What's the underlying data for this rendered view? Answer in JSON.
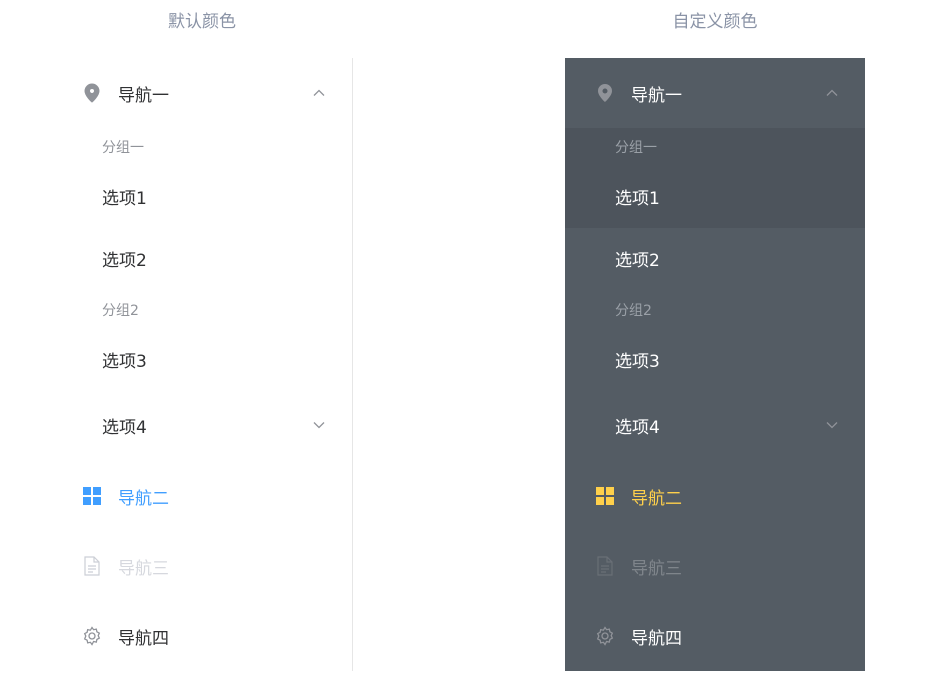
{
  "columns": {
    "left_title": "默认颜色",
    "right_title": "自定义颜色"
  },
  "menu": {
    "nav1": "导航一",
    "group1": "分组一",
    "option1": "选项1",
    "option2": "选项2",
    "group2": "分组2",
    "option3": "选项3",
    "option4": "选项4",
    "nav2": "导航二",
    "nav3": "导航三",
    "nav4": "导航四"
  },
  "icons": {
    "nav1": "location-icon",
    "nav2": "grid-menu-icon",
    "nav3": "document-icon",
    "nav4": "gear-icon",
    "expanded": "chevron-up-icon",
    "collapsed": "chevron-down-icon"
  },
  "colors": {
    "custom_background": "#545c64",
    "custom_text": "#ffffff",
    "custom_active": "#ffd04b",
    "default_active": "#409eff",
    "default_text": "#303133"
  }
}
